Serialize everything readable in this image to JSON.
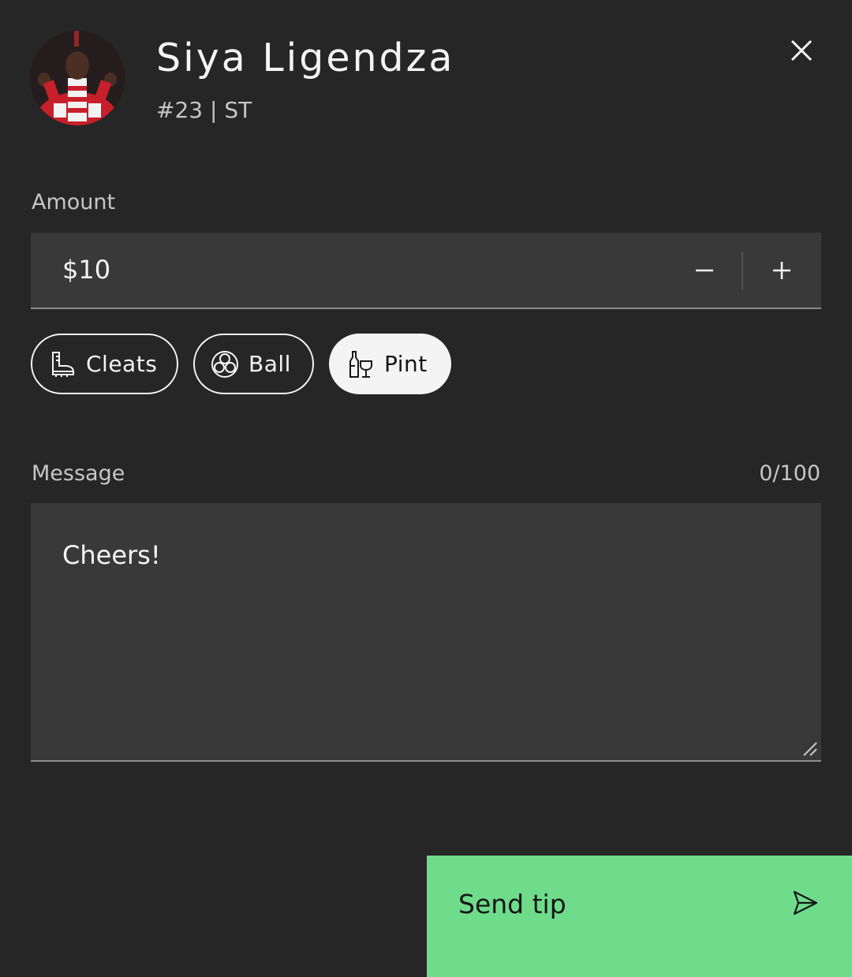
{
  "player": {
    "name": "Siya Ligendza",
    "meta": "#23 | ST",
    "avatar_icon": "player-photo"
  },
  "dialog": {
    "close_icon": "close-icon"
  },
  "amount": {
    "label": "Amount",
    "value": "$10",
    "decrement_icon": "minus-icon",
    "increment_icon": "plus-icon"
  },
  "chips": [
    {
      "label": "Cleats",
      "icon": "boot-icon",
      "selected": false
    },
    {
      "label": "Ball",
      "icon": "soccer-ball-icon",
      "selected": false
    },
    {
      "label": "Pint",
      "icon": "drinks-icon",
      "selected": true
    }
  ],
  "message": {
    "label": "Message",
    "count": "0/100",
    "value": "Cheers!"
  },
  "send": {
    "label": "Send tip",
    "icon": "send-icon"
  },
  "colors": {
    "background": "#262626",
    "field": "#393939",
    "accent_green": "#6fdc8c",
    "text_primary": "#f4f4f4",
    "text_secondary": "#c6c6c6"
  }
}
